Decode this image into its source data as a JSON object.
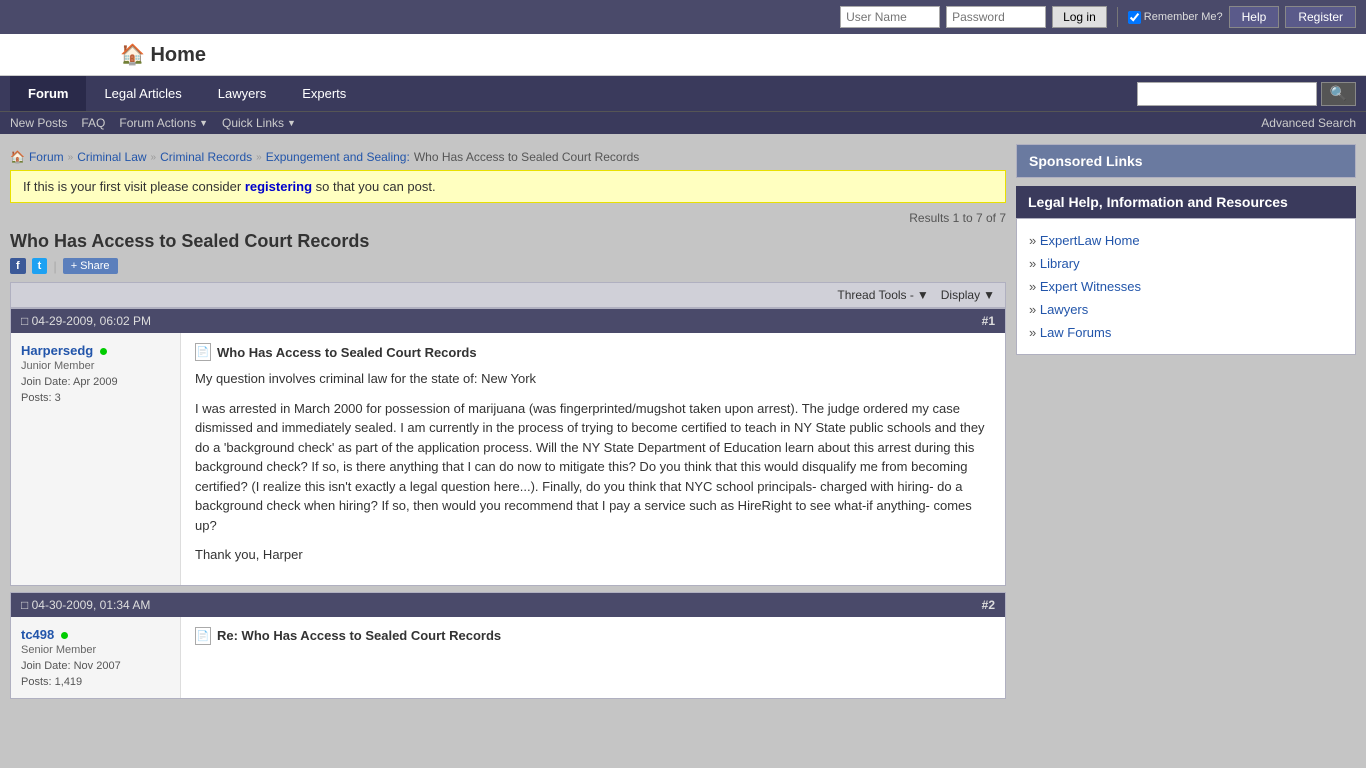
{
  "topbar": {
    "username_placeholder": "User Name",
    "password_placeholder": "Password",
    "login_btn": "Log in",
    "remember_me": "Remember Me?",
    "help_btn": "Help",
    "register_btn": "Register"
  },
  "logo": {
    "text": "Home"
  },
  "nav": {
    "tabs": [
      {
        "label": "Forum",
        "active": true
      },
      {
        "label": "Legal Articles",
        "active": false
      },
      {
        "label": "Lawyers",
        "active": false
      },
      {
        "label": "Experts",
        "active": false
      }
    ],
    "search_placeholder": ""
  },
  "subnav": {
    "new_posts": "New Posts",
    "faq": "FAQ",
    "forum_actions": "Forum Actions",
    "quick_links": "Quick Links",
    "advanced_search": "Advanced Search"
  },
  "breadcrumb": {
    "home": "Forum",
    "items": [
      "Criminal Law",
      "Criminal Records",
      "Expungement and Sealing:"
    ],
    "current": "Who Has Access to Sealed Court Records"
  },
  "first_visit": {
    "text_before": "If this is your first visit please consider",
    "link_text": "registering",
    "text_after": "so that you can post."
  },
  "results": {
    "text": "Results 1 to 7 of 7"
  },
  "thread": {
    "title": "Who Has Access to Sealed Court Records",
    "share_label": "Share"
  },
  "tools": {
    "thread_tools": "Thread Tools -",
    "display": "Display"
  },
  "posts": [
    {
      "id": "post1",
      "date": "04-29-2009,",
      "time": "06:02 PM",
      "num": "#1",
      "username": "Harpersedg",
      "online": true,
      "rank": "Junior Member",
      "join_date_label": "Join Date:",
      "join_date": "Apr 2009",
      "posts_label": "Posts:",
      "posts": "3",
      "post_title": "Who Has Access to Sealed Court Records",
      "body_p1": "My question involves criminal law for the state of: New York",
      "body_p2": "I was arrested in March 2000 for possession of marijuana (was fingerprinted/mugshot taken upon arrest). The judge ordered my case dismissed and immediately sealed. I am currently in the process of trying to become certified to teach in NY State public schools and they do a 'background check' as part of the application process. Will the NY State Department of Education learn about this arrest during this background check? If so, is there anything that I can do now to mitigate this? Do you think that this would disqualify me from becoming certified? (I realize this isn't exactly a legal question here...). Finally, do you think that NYC school principals- charged with hiring- do a background check when hiring? If so, then would you recommend that I pay a service such as HireRight to see what-if anything- comes up?",
      "body_p3": "Thank you, Harper"
    },
    {
      "id": "post2",
      "date": "04-30-2009,",
      "time": "01:34 AM",
      "num": "#2",
      "username": "tc498",
      "online": true,
      "rank": "Senior Member",
      "join_date_label": "Join Date:",
      "join_date": "Nov 2007",
      "posts_label": "Posts:",
      "posts": "1,419",
      "post_title": "Re: Who Has Access to Sealed Court Records",
      "body_p1": "",
      "body_p2": "",
      "body_p3": ""
    }
  ],
  "sidebar": {
    "sponsored_header": "Sponsored Links",
    "legal_help_header": "Legal Help, Information and Resources",
    "links": [
      {
        "label": "ExpertLaw Home"
      },
      {
        "label": "Library"
      },
      {
        "label": "Expert Witnesses"
      },
      {
        "label": "Lawyers"
      },
      {
        "label": "Law Forums"
      }
    ]
  }
}
